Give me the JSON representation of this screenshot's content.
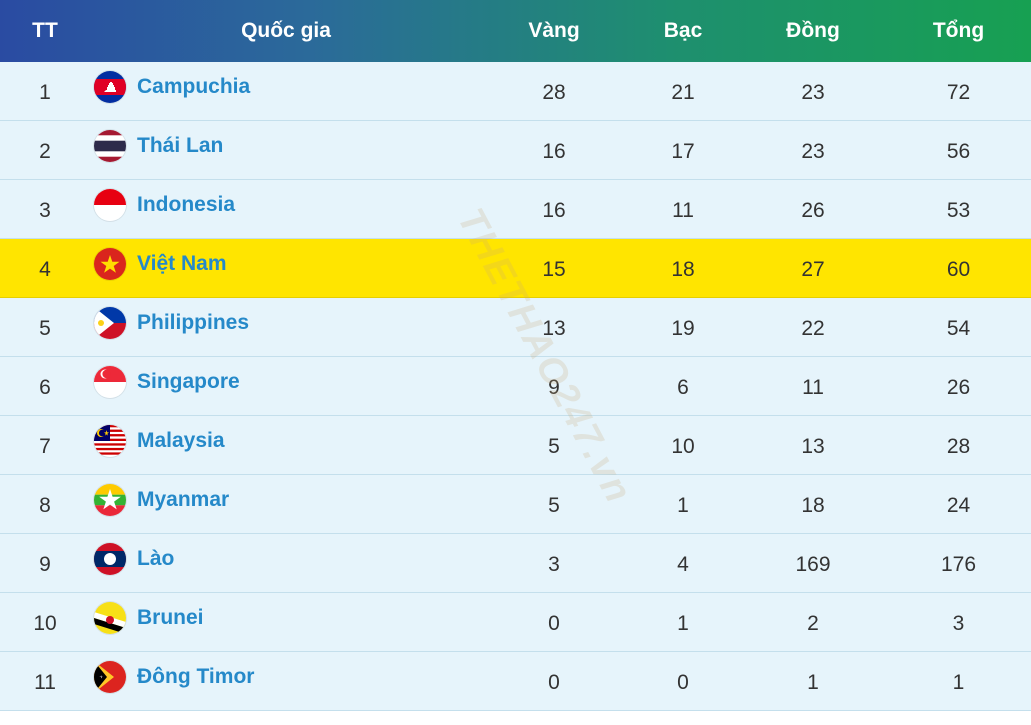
{
  "header": {
    "rank": "TT",
    "country": "Quốc gia",
    "gold": "Vàng",
    "silver": "Bạc",
    "bronze": "Đồng",
    "total": "Tổng"
  },
  "watermark": "THETHAO247.vn",
  "highlight_color": "#ffe500",
  "rows": [
    {
      "rank": "1",
      "country": "Campuchia",
      "flag_icon": "cambodia-flag-icon",
      "gold": "28",
      "silver": "21",
      "bronze": "23",
      "total": "72"
    },
    {
      "rank": "2",
      "country": "Thái Lan",
      "flag_icon": "thailand-flag-icon",
      "gold": "16",
      "silver": "17",
      "bronze": "23",
      "total": "56"
    },
    {
      "rank": "3",
      "country": "Indonesia",
      "flag_icon": "indonesia-flag-icon",
      "gold": "16",
      "silver": "11",
      "bronze": "26",
      "total": "53"
    },
    {
      "rank": "4",
      "country": "Việt Nam",
      "flag_icon": "vietnam-flag-icon",
      "gold": "15",
      "silver": "18",
      "bronze": "27",
      "total": "60"
    },
    {
      "rank": "5",
      "country": "Philippines",
      "flag_icon": "philippines-flag-icon",
      "gold": "13",
      "silver": "19",
      "bronze": "22",
      "total": "54"
    },
    {
      "rank": "6",
      "country": "Singapore",
      "flag_icon": "singapore-flag-icon",
      "gold": "9",
      "silver": "6",
      "bronze": "11",
      "total": "26"
    },
    {
      "rank": "7",
      "country": "Malaysia",
      "flag_icon": "malaysia-flag-icon",
      "gold": "5",
      "silver": "10",
      "bronze": "13",
      "total": "28"
    },
    {
      "rank": "8",
      "country": "Myanmar",
      "flag_icon": "myanmar-flag-icon",
      "gold": "5",
      "silver": "1",
      "bronze": "18",
      "total": "24"
    },
    {
      "rank": "9",
      "country": "Lào",
      "flag_icon": "laos-flag-icon",
      "gold": "3",
      "silver": "4",
      "bronze": "169",
      "total": "176"
    },
    {
      "rank": "10",
      "country": "Brunei",
      "flag_icon": "brunei-flag-icon",
      "gold": "0",
      "silver": "1",
      "bronze": "2",
      "total": "3"
    },
    {
      "rank": "11",
      "country": "Đông Timor",
      "flag_icon": "timor-leste-flag-icon",
      "gold": "0",
      "silver": "0",
      "bronze": "1",
      "total": "1"
    }
  ]
}
